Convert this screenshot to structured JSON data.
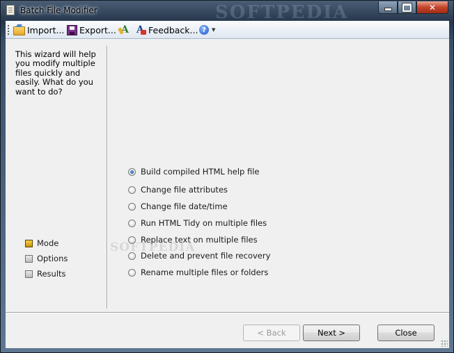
{
  "window": {
    "title": "Batch File Modifier",
    "watermark": "SOFTPEDIA",
    "controls": {
      "close_glyph": "✕"
    }
  },
  "toolbar": {
    "import_label": "Import...",
    "export_label": "Export...",
    "feedback_label": "Feedback...",
    "help_glyph": "?",
    "dropdown_glyph": "▼"
  },
  "sidebar": {
    "intro": "This wizard will help you modify multiple files quickly and easily. What do you want to do?",
    "steps": [
      {
        "label": "Mode",
        "active": true
      },
      {
        "label": "Options",
        "active": false
      },
      {
        "label": "Results",
        "active": false
      }
    ]
  },
  "options": [
    {
      "label": "Build compiled HTML help file",
      "checked": true
    },
    {
      "label": "Change file attributes",
      "checked": false
    },
    {
      "label": "Change file date/time",
      "checked": false
    },
    {
      "label": "Run HTML Tidy on multiple files",
      "checked": false
    },
    {
      "label": "Replace text on multiple files",
      "checked": false
    },
    {
      "label": "Delete and prevent file recovery",
      "checked": false
    },
    {
      "label": "Rename multiple files or folders",
      "checked": false
    }
  ],
  "overlay_watermark": "SOFTPEDIA",
  "buttons": {
    "back": "< Back",
    "next": "Next >",
    "close": "Close"
  }
}
